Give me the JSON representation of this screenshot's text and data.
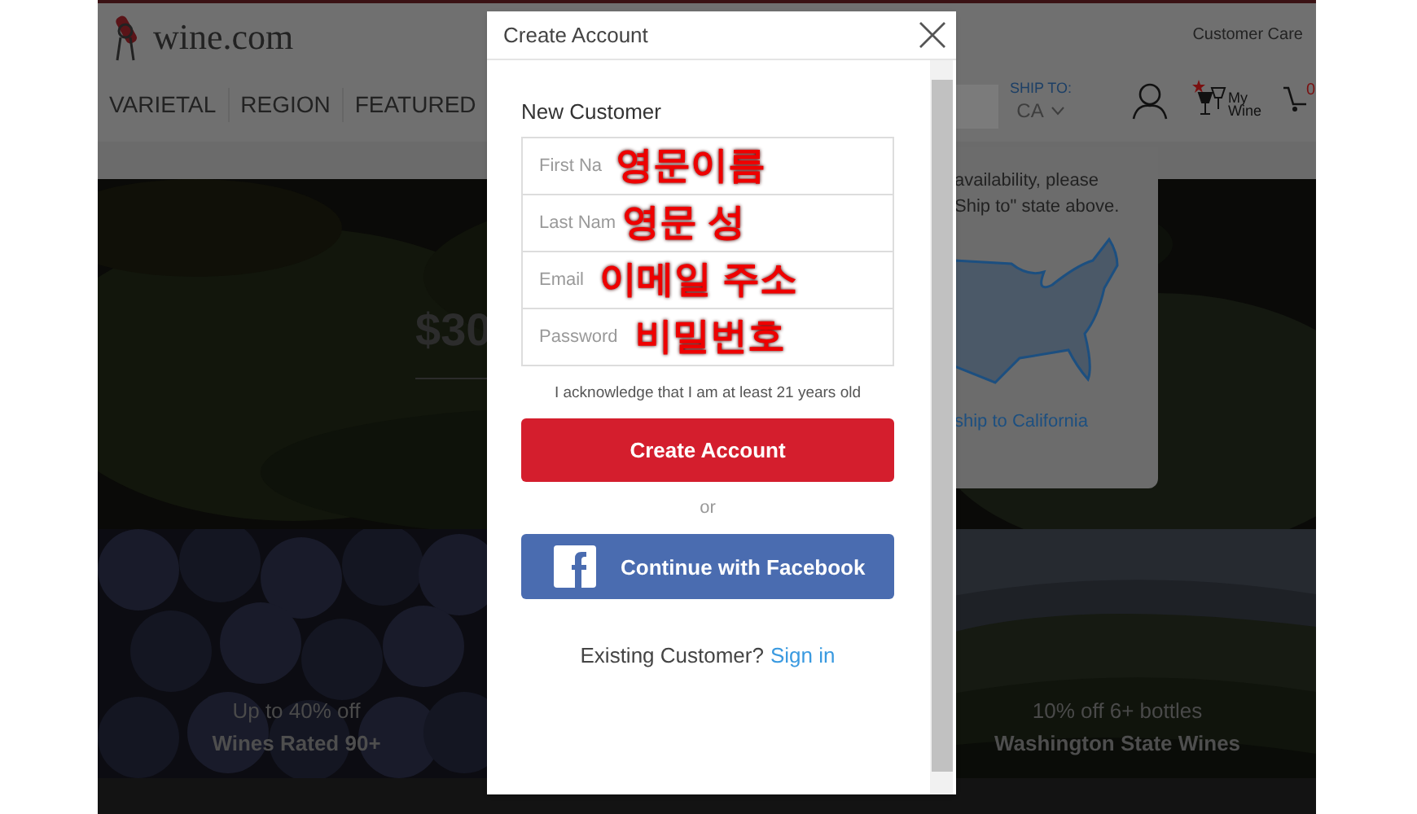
{
  "page": {
    "logo": "wine.com",
    "customer_care": "Customer Care",
    "nav": [
      {
        "label": "VARIETAL"
      },
      {
        "label": "REGION"
      },
      {
        "label": "FEATURED"
      }
    ],
    "ship_to": {
      "label": "SHIP TO:",
      "state": "CA"
    },
    "my_wine": "My Wine",
    "cart_count": "0",
    "ship_popup": {
      "lines": [
        "availability, please",
        "Ship to\" state above."
      ],
      "link": "ship to California"
    },
    "hero": {
      "price": "$30"
    },
    "tiles": [
      {
        "line1": "Up to 40% off",
        "line2": "Wines Rated 90+"
      },
      {
        "line1": "10% off 6+ bottles",
        "line2": "Washington State Wines"
      }
    ]
  },
  "modal": {
    "title": "Create Account",
    "section": "New Customer",
    "fields": [
      {
        "placeholder": "First Na",
        "note": "영문이름"
      },
      {
        "placeholder": "Last Nam",
        "note": "영문 성"
      },
      {
        "placeholder": "Email",
        "note": "이메일 주소"
      },
      {
        "placeholder": "Password",
        "note": "비밀번호"
      }
    ],
    "acknowledgement": "I acknowledge that I am at least 21 years old",
    "primary_button": "Create Account",
    "or": "or",
    "facebook_button": "Continue with Facebook",
    "existing": "Existing Customer?",
    "sign_in": "Sign in"
  }
}
